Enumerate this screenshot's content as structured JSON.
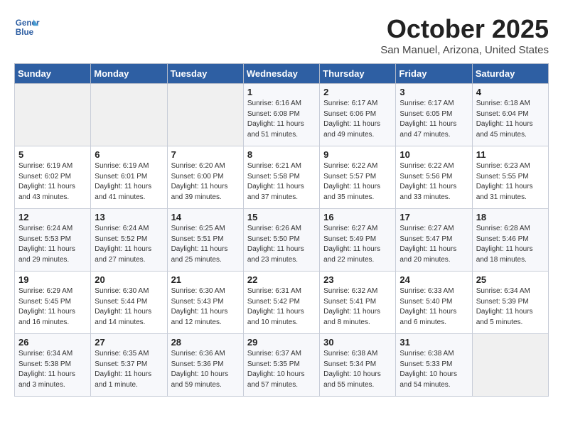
{
  "logo": {
    "line1": "General",
    "line2": "Blue"
  },
  "title": "October 2025",
  "subtitle": "San Manuel, Arizona, United States",
  "weekdays": [
    "Sunday",
    "Monday",
    "Tuesday",
    "Wednesday",
    "Thursday",
    "Friday",
    "Saturday"
  ],
  "weeks": [
    [
      {
        "day": "",
        "info": ""
      },
      {
        "day": "",
        "info": ""
      },
      {
        "day": "",
        "info": ""
      },
      {
        "day": "1",
        "info": "Sunrise: 6:16 AM\nSunset: 6:08 PM\nDaylight: 11 hours\nand 51 minutes."
      },
      {
        "day": "2",
        "info": "Sunrise: 6:17 AM\nSunset: 6:06 PM\nDaylight: 11 hours\nand 49 minutes."
      },
      {
        "day": "3",
        "info": "Sunrise: 6:17 AM\nSunset: 6:05 PM\nDaylight: 11 hours\nand 47 minutes."
      },
      {
        "day": "4",
        "info": "Sunrise: 6:18 AM\nSunset: 6:04 PM\nDaylight: 11 hours\nand 45 minutes."
      }
    ],
    [
      {
        "day": "5",
        "info": "Sunrise: 6:19 AM\nSunset: 6:02 PM\nDaylight: 11 hours\nand 43 minutes."
      },
      {
        "day": "6",
        "info": "Sunrise: 6:19 AM\nSunset: 6:01 PM\nDaylight: 11 hours\nand 41 minutes."
      },
      {
        "day": "7",
        "info": "Sunrise: 6:20 AM\nSunset: 6:00 PM\nDaylight: 11 hours\nand 39 minutes."
      },
      {
        "day": "8",
        "info": "Sunrise: 6:21 AM\nSunset: 5:58 PM\nDaylight: 11 hours\nand 37 minutes."
      },
      {
        "day": "9",
        "info": "Sunrise: 6:22 AM\nSunset: 5:57 PM\nDaylight: 11 hours\nand 35 minutes."
      },
      {
        "day": "10",
        "info": "Sunrise: 6:22 AM\nSunset: 5:56 PM\nDaylight: 11 hours\nand 33 minutes."
      },
      {
        "day": "11",
        "info": "Sunrise: 6:23 AM\nSunset: 5:55 PM\nDaylight: 11 hours\nand 31 minutes."
      }
    ],
    [
      {
        "day": "12",
        "info": "Sunrise: 6:24 AM\nSunset: 5:53 PM\nDaylight: 11 hours\nand 29 minutes."
      },
      {
        "day": "13",
        "info": "Sunrise: 6:24 AM\nSunset: 5:52 PM\nDaylight: 11 hours\nand 27 minutes."
      },
      {
        "day": "14",
        "info": "Sunrise: 6:25 AM\nSunset: 5:51 PM\nDaylight: 11 hours\nand 25 minutes."
      },
      {
        "day": "15",
        "info": "Sunrise: 6:26 AM\nSunset: 5:50 PM\nDaylight: 11 hours\nand 23 minutes."
      },
      {
        "day": "16",
        "info": "Sunrise: 6:27 AM\nSunset: 5:49 PM\nDaylight: 11 hours\nand 22 minutes."
      },
      {
        "day": "17",
        "info": "Sunrise: 6:27 AM\nSunset: 5:47 PM\nDaylight: 11 hours\nand 20 minutes."
      },
      {
        "day": "18",
        "info": "Sunrise: 6:28 AM\nSunset: 5:46 PM\nDaylight: 11 hours\nand 18 minutes."
      }
    ],
    [
      {
        "day": "19",
        "info": "Sunrise: 6:29 AM\nSunset: 5:45 PM\nDaylight: 11 hours\nand 16 minutes."
      },
      {
        "day": "20",
        "info": "Sunrise: 6:30 AM\nSunset: 5:44 PM\nDaylight: 11 hours\nand 14 minutes."
      },
      {
        "day": "21",
        "info": "Sunrise: 6:30 AM\nSunset: 5:43 PM\nDaylight: 11 hours\nand 12 minutes."
      },
      {
        "day": "22",
        "info": "Sunrise: 6:31 AM\nSunset: 5:42 PM\nDaylight: 11 hours\nand 10 minutes."
      },
      {
        "day": "23",
        "info": "Sunrise: 6:32 AM\nSunset: 5:41 PM\nDaylight: 11 hours\nand 8 minutes."
      },
      {
        "day": "24",
        "info": "Sunrise: 6:33 AM\nSunset: 5:40 PM\nDaylight: 11 hours\nand 6 minutes."
      },
      {
        "day": "25",
        "info": "Sunrise: 6:34 AM\nSunset: 5:39 PM\nDaylight: 11 hours\nand 5 minutes."
      }
    ],
    [
      {
        "day": "26",
        "info": "Sunrise: 6:34 AM\nSunset: 5:38 PM\nDaylight: 11 hours\nand 3 minutes."
      },
      {
        "day": "27",
        "info": "Sunrise: 6:35 AM\nSunset: 5:37 PM\nDaylight: 11 hours\nand 1 minute."
      },
      {
        "day": "28",
        "info": "Sunrise: 6:36 AM\nSunset: 5:36 PM\nDaylight: 10 hours\nand 59 minutes."
      },
      {
        "day": "29",
        "info": "Sunrise: 6:37 AM\nSunset: 5:35 PM\nDaylight: 10 hours\nand 57 minutes."
      },
      {
        "day": "30",
        "info": "Sunrise: 6:38 AM\nSunset: 5:34 PM\nDaylight: 10 hours\nand 55 minutes."
      },
      {
        "day": "31",
        "info": "Sunrise: 6:38 AM\nSunset: 5:33 PM\nDaylight: 10 hours\nand 54 minutes."
      },
      {
        "day": "",
        "info": ""
      }
    ]
  ]
}
